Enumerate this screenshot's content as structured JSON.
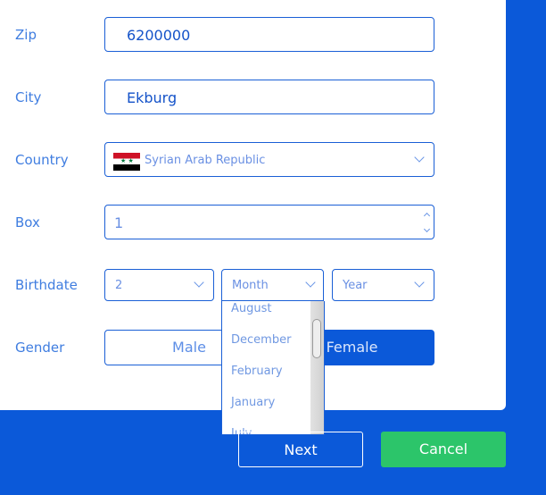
{
  "form": {
    "zip": {
      "label": "Zip",
      "value": "6200000"
    },
    "city": {
      "label": "City",
      "value": "Ekburg"
    },
    "country": {
      "label": "Country",
      "value": "Syrian Arab Republic",
      "flag": "syria-flag-icon"
    },
    "box": {
      "label": "Box",
      "value": "1"
    },
    "birthdate": {
      "label": "Birthdate",
      "day": "2",
      "month": "Month",
      "year": "Year",
      "month_options": [
        "August",
        "December",
        "February",
        "January",
        "July"
      ]
    },
    "gender": {
      "label": "Gender",
      "options": [
        "Male",
        "Female"
      ],
      "selected": "Female"
    }
  },
  "buttons": {
    "next": "Next",
    "cancel": "Cancel"
  },
  "colors": {
    "background": "#0b59d9",
    "cancel": "#2cc56a"
  }
}
